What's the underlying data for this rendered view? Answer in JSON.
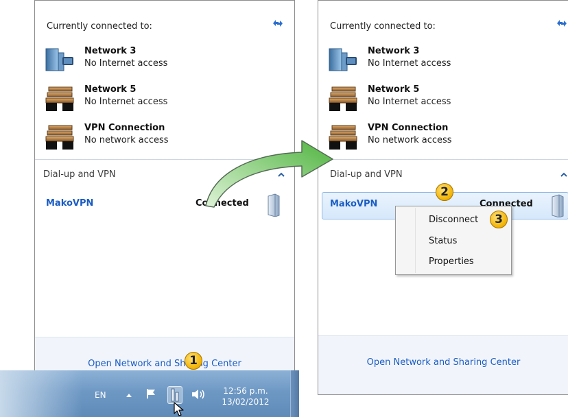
{
  "left_panel": {
    "currently_connected_label": "Currently connected to:",
    "networks": [
      {
        "name": "Network 3",
        "status": "No Internet access",
        "icon": "network-icon"
      },
      {
        "name": "Network 5",
        "status": "No Internet access",
        "icon": "bench-icon"
      },
      {
        "name": "VPN Connection",
        "status": "No network access",
        "icon": "bench-icon"
      }
    ],
    "dialup_label": "Dial-up and VPN",
    "vpn": {
      "name": "MakoVPN",
      "status": "Connected"
    },
    "footer_link": "Open Network and Sharing Center"
  },
  "right_panel": {
    "currently_connected_label": "Currently connected to:",
    "networks": [
      {
        "name": "Network 3",
        "status": "No Internet access",
        "icon": "network-icon"
      },
      {
        "name": "Network 5",
        "status": "No Internet access",
        "icon": "bench-icon"
      },
      {
        "name": "VPN Connection",
        "status": "No network access",
        "icon": "bench-icon"
      }
    ],
    "dialup_label": "Dial-up and VPN",
    "vpn": {
      "name": "MakoVPN",
      "status": "Connected"
    },
    "footer_link": "Open Network and Sharing Center"
  },
  "context_menu": {
    "items": [
      "Disconnect",
      "Status",
      "Properties"
    ]
  },
  "taskbar": {
    "language": "EN",
    "time": "12:56 p.m.",
    "date": "13/02/2012"
  },
  "badges": [
    "1",
    "2",
    "3"
  ],
  "colors": {
    "link_blue": "#1a5cc4",
    "selection_bg": "#d6e8fb",
    "taskbar": "#6e98c4",
    "badge": "#f2b200",
    "arrow": "#66c05a"
  }
}
